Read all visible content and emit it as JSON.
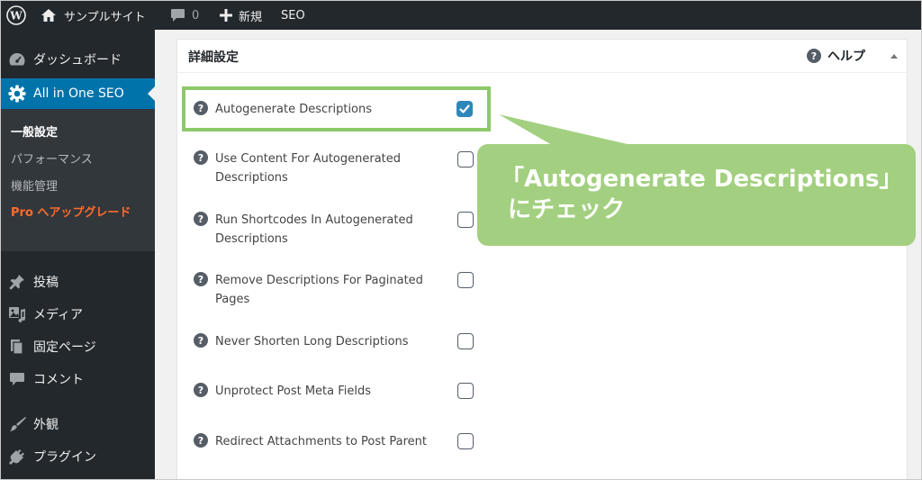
{
  "admin_bar": {
    "site_name": "サンプルサイト",
    "comment_count": "0",
    "new_label": "新規",
    "seo_label": "SEO"
  },
  "sidebar": {
    "dashboard": "ダッシュボード",
    "aioseo": "All in One SEO",
    "submenu": {
      "general": "一般設定",
      "performance": "パフォーマンス",
      "features": "機能管理",
      "pro_prefix": "Pro",
      "pro_upgrade": "へアップグレード"
    },
    "posts": "投稿",
    "media": "メディア",
    "pages": "固定ページ",
    "comments": "コメント",
    "appearance": "外観",
    "plugins": "プラグイン"
  },
  "panel": {
    "title": "詳細設定",
    "help_label": "ヘルプ",
    "help_glyph": "?"
  },
  "options": [
    {
      "label": "Autogenerate Descriptions",
      "checked": true
    },
    {
      "label": "Use Content For Autogenerated Descriptions",
      "checked": false
    },
    {
      "label": "Run Shortcodes In Autogenerated Descriptions",
      "checked": false
    },
    {
      "label": "Remove Descriptions For Paginated Pages",
      "checked": false
    },
    {
      "label": "Never Shorten Long Descriptions",
      "checked": false
    },
    {
      "label": "Unprotect Post Meta Fields",
      "checked": false
    },
    {
      "label": "Redirect Attachments to Post Parent",
      "checked": false
    }
  ],
  "callout": {
    "line1": "「Autogenerate Descriptions」",
    "line2": "にチェック"
  },
  "colors": {
    "admin_bar": "#23282d",
    "sidebar_active": "#0073aa",
    "pro_orange": "#ff6b2b",
    "highlight_green": "#8dc86a",
    "callout_green": "#a3d080",
    "checkbox_checked": "#2e87b9"
  },
  "icons": [
    "wordpress-icon",
    "home-icon",
    "comment-icon",
    "plus-icon",
    "dashboard-icon",
    "gear-icon",
    "pin-icon",
    "media-icon",
    "pages-icon",
    "comments-icon",
    "brush-icon",
    "plugin-icon",
    "question-icon",
    "checkmark-icon"
  ]
}
